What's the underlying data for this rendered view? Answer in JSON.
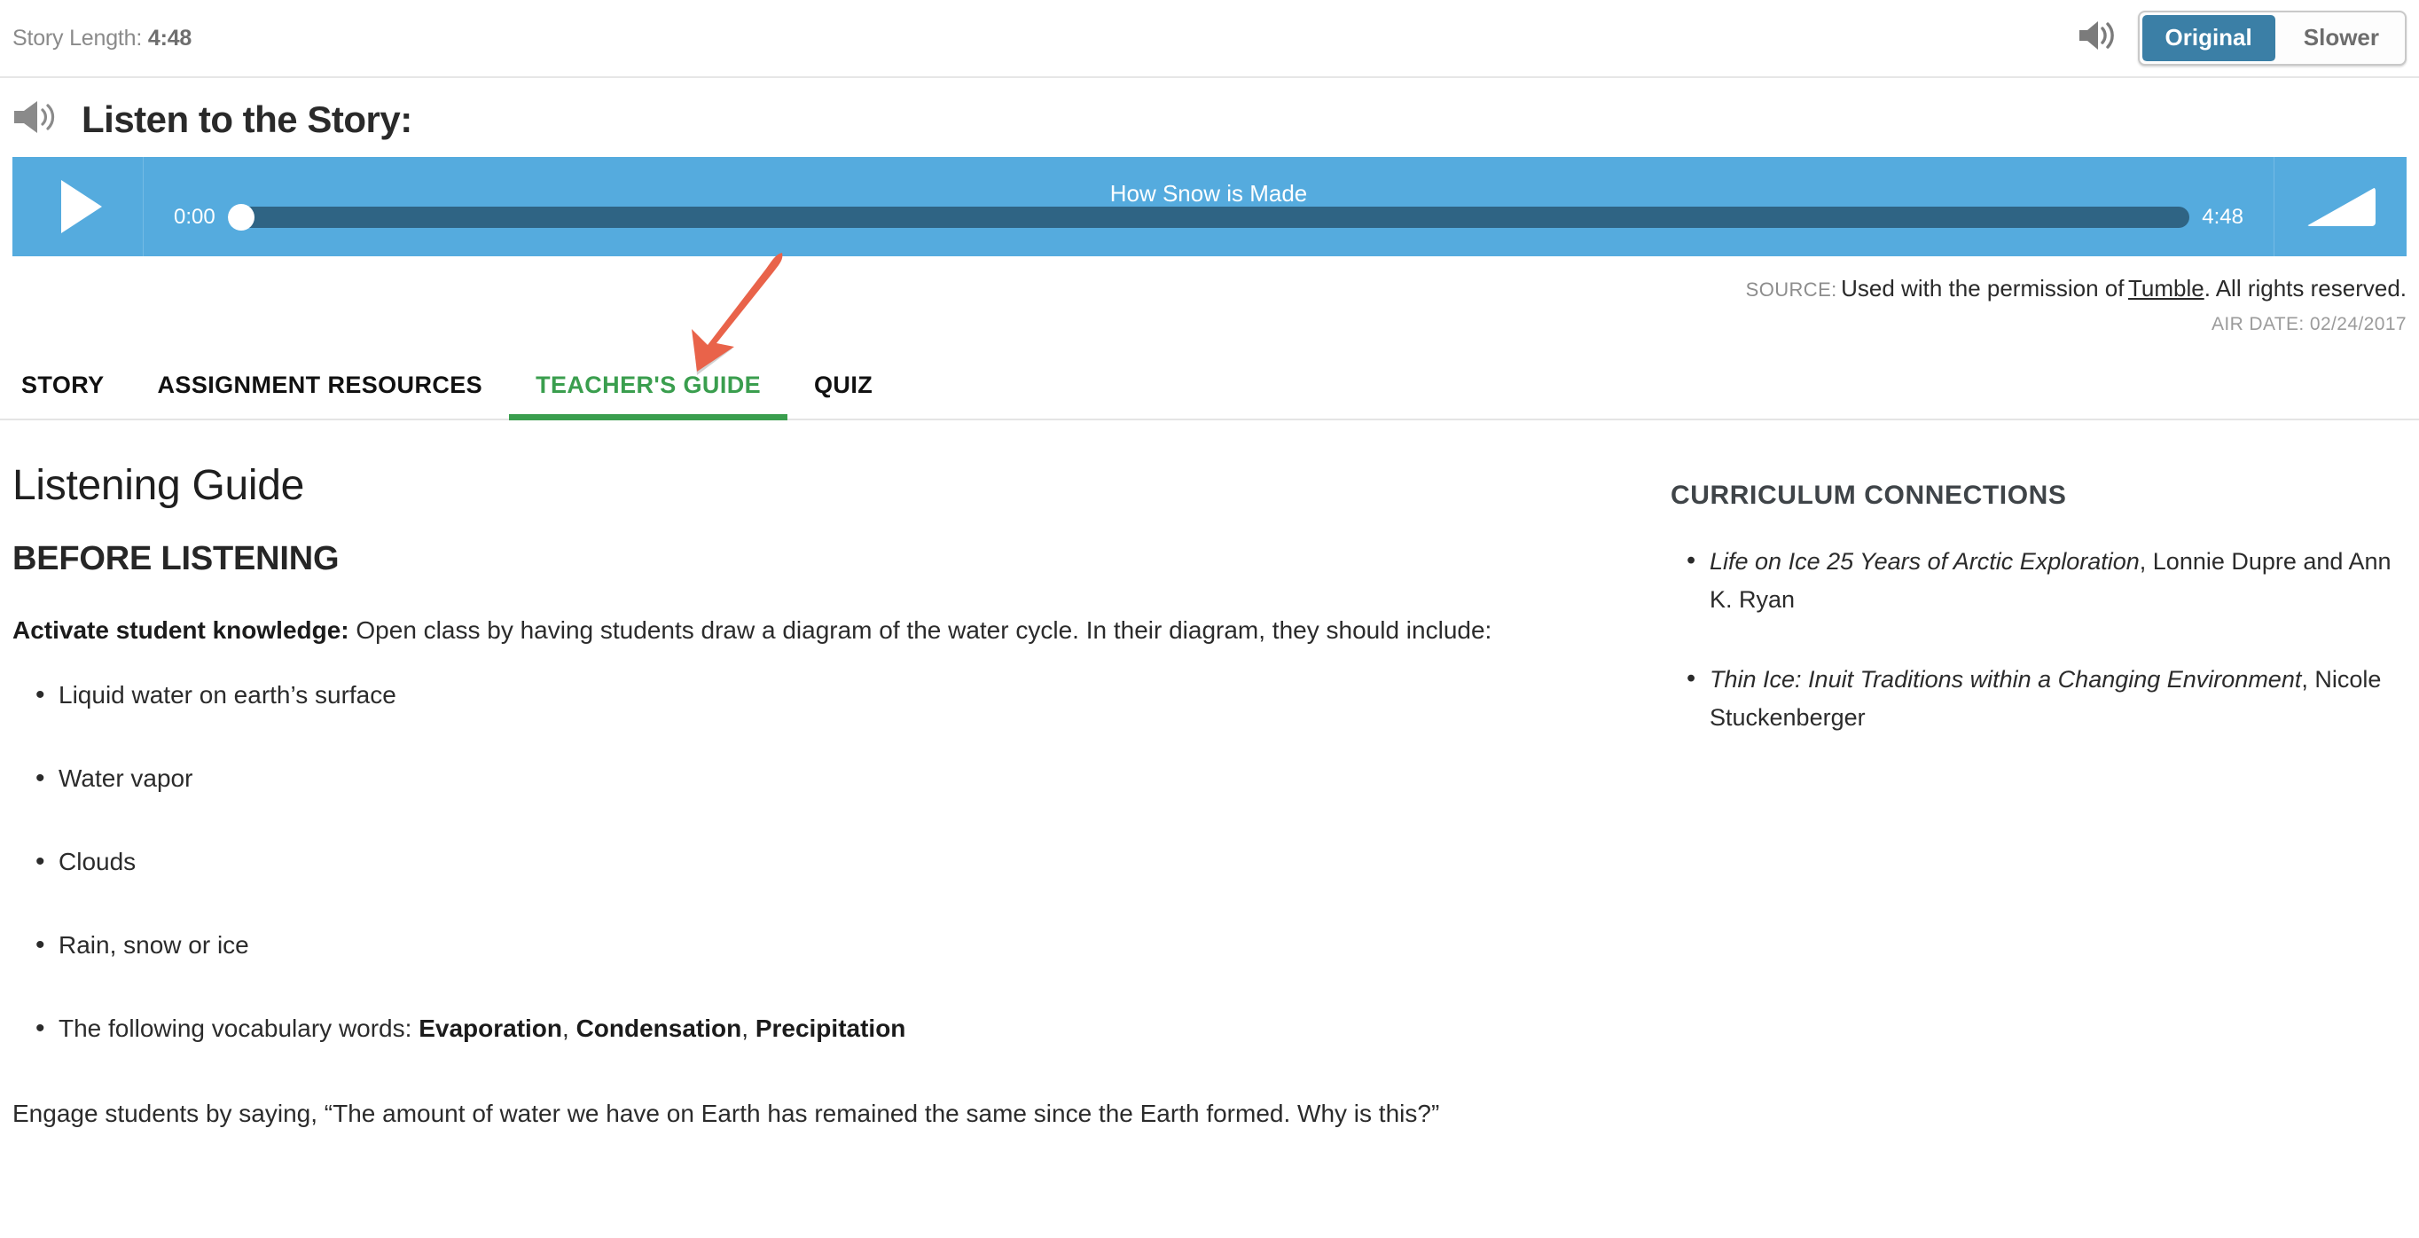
{
  "topbar": {
    "story_length_label": "Story Length:",
    "story_length_value": "4:48",
    "speaker_icon": "speaker-volume-icon",
    "speed_original": "Original",
    "speed_slower": "Slower",
    "speed_selected": "Original"
  },
  "listen": {
    "speaker_icon": "speaker-volume-icon",
    "heading": "Listen to the Story:"
  },
  "player": {
    "play_icon": "play-triangle-icon",
    "track_title": "How Snow is Made",
    "current_time": "0:00",
    "total_time": "4:48",
    "volume_icon": "volume-wedge-icon",
    "progress_percent": 0,
    "bar_color": "#2f6484",
    "player_bg": "#55abde"
  },
  "source": {
    "label": "SOURCE:",
    "text_before": "Used with the permission of",
    "link": "Tumble",
    "text_after": ". All rights reserved.",
    "air_date": "AIR DATE: 02/24/2017",
    "link_color": "#2f72b8"
  },
  "tabs": {
    "items": [
      {
        "label": "STORY",
        "active": false
      },
      {
        "label": "ASSIGNMENT RESOURCES",
        "active": false
      },
      {
        "label": "TEACHER'S GUIDE",
        "active": true
      },
      {
        "label": "QUIZ",
        "active": false
      }
    ],
    "active_color": "#3a9e4e",
    "annotation_arrow": {
      "icon": "down-left-arrow-annotation-icon",
      "color": "#e9634a",
      "points_to": "TEACHER'S GUIDE"
    }
  },
  "main": {
    "title": "Listening Guide",
    "section_heading": "BEFORE LISTENING",
    "activate_label": "Activate student knowledge:",
    "activate_text": " Open class by having students draw a diagram of the water cycle. In their diagram, they should include:",
    "bullets": [
      {
        "text": "Liquid water on earth’s surface"
      },
      {
        "text": "Water vapor"
      },
      {
        "text": "Clouds"
      },
      {
        "text": "Rain, snow or ice"
      },
      {
        "text": "The following vocabulary words: ",
        "bold_terms": [
          "Evaporation",
          "Condensation",
          "Precipitation"
        ]
      }
    ],
    "closing_paragraph": "Engage students by saying, “The amount of water we have on Earth has remained the same since the Earth formed. Why is this?”"
  },
  "sidebar": {
    "title": "CURRICULUM CONNECTIONS",
    "items": [
      {
        "italic": "Life on Ice 25 Years of Arctic Exploration",
        "rest": ", Lonnie Dupre and Ann K. Ryan"
      },
      {
        "italic": "Thin Ice: Inuit Traditions within a Changing Environment",
        "rest": ", Nicole Stuckenberger"
      }
    ]
  }
}
